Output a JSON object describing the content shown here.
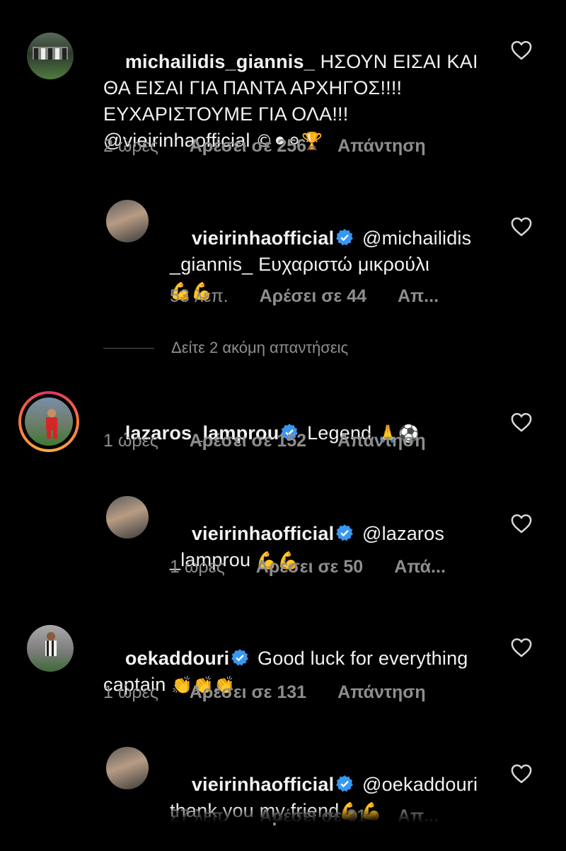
{
  "comments": [
    {
      "username": "michailidis_giannis_",
      "verified": false,
      "text": "ΗΣΟΥΝ ΕΙΣΑΙ ΚΑΙ ΘΑ ΕΙΣΑΙ ΓΙΑ ΠΑΝΤΑ ΑΡΧΗΓΟΣ!!!! ΕΥΧΑΡΙΣΤΟΥΜΕ ΓΙΑ ΟΛΑ!!! @vieirinhaofficial",
      "emoji": "©⚫⚪🏆",
      "time": "2 ώρες",
      "likes": "Αρέσει σε 256",
      "reply": "Απάντηση"
    },
    {
      "username": "vieirinhaofficial",
      "verified": true,
      "mention": "@michailidis",
      "text_line2": "_giannis_ Ευχαριστώ μικρούλι",
      "emoji": "💪💪",
      "time": "53 λεπ.",
      "likes": "Αρέσει σε 44",
      "reply": "Απ..."
    },
    {
      "username": "lazaros_lamprou",
      "verified": true,
      "text": "Legend",
      "emoji": "🙏⚽",
      "time": "1 ώρες",
      "likes": "Αρέσει σε 152",
      "reply": "Απάντηση"
    },
    {
      "username": "vieirinhaofficial",
      "verified": true,
      "mention": "@lazaros",
      "text_line2": "_lamprou",
      "emoji": "💪💪",
      "time": "1 ώρες",
      "likes": "Αρέσει σε 50",
      "reply": "Απά..."
    },
    {
      "username": "oekaddouri",
      "verified": true,
      "text": "Good luck for everything",
      "text_line2": "captain",
      "emoji": "👏👏👏",
      "time": "1 ώρες",
      "likes": "Αρέσει σε 131",
      "reply": "Απάντηση"
    },
    {
      "username": "vieirinhaofficial",
      "verified": true,
      "mention": "@oekaddouri",
      "text_line2": "thank you my friend",
      "emoji": "💪💪",
      "time": "27 λεπ.",
      "likes": "Αρέσει σε 31",
      "reply": "Απ..."
    }
  ],
  "view_more_replies": "Δείτε 2 ακόμη απαντήσεις",
  "colors": {
    "background": "#000000",
    "meta": "#8e8e8e",
    "verified": "#3897f0",
    "text": "#f2f2f2"
  },
  "icons": {
    "heart": "heart-outline-icon",
    "verified": "verified-badge-icon"
  }
}
